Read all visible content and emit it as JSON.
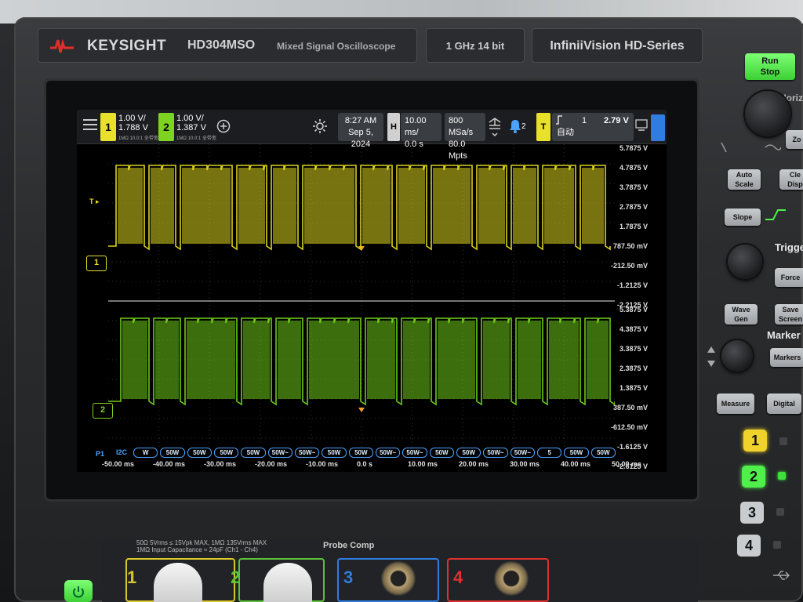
{
  "branding": {
    "company": "KEYSIGHT",
    "model": "HD304MSO",
    "type": "Mixed Signal Oscilloscope",
    "spec": "1 GHz  14 bit",
    "series": "InfiniiVision  HD-Series"
  },
  "topbar": {
    "ch1": {
      "num": "1",
      "scale": "1.00 V/",
      "offset": "1.788 V",
      "meta": "1MΩ  10.0:1  全带宽"
    },
    "ch2": {
      "num": "2",
      "scale": "1.00 V/",
      "offset": "1.387 V",
      "meta": "1MΩ  10.0:1  全带宽"
    },
    "add_icon": "plus-circle-icon",
    "brightness_icon": "sun-icon",
    "time": "8:27 AM",
    "date": "Sep 5, 2024",
    "horizontal_label": "H",
    "timebase": "10.00 ms/",
    "delay": "0.0 s",
    "sample_rate": "800 MSa/s",
    "memory": "80.0 Mpts",
    "notifications": "2",
    "trigger_label": "T",
    "trigger_source": "1",
    "trigger_mode": "自动",
    "trigger_level": "2.79 V"
  },
  "colors": {
    "ch1": "#e8e02a",
    "ch2": "#7ed321",
    "trace_ch1": "#d9d21e",
    "trace_ch2": "#6fc91a",
    "run_stop": "#4ff04a"
  },
  "ch1_labels": [
    "5.7875 V",
    "4.7875 V",
    "3.7875 V",
    "2.7875 V",
    "1.7875 V",
    "787.50 mV",
    "-212.50 mV",
    "-1.2125 V",
    "-2.2125 V"
  ],
  "ch2_labels": [
    "5.3875 V",
    "4.3875 V",
    "3.3875 V",
    "2.3875 V",
    "1.3875 V",
    "387.50 mV",
    "-612.50 mV",
    "-1.6125 V",
    "-2.6125 V"
  ],
  "time_labels": [
    "-50.00 ms",
    "-40.00 ms",
    "-30.00 ms",
    "-20.00 ms",
    "-10.00 ms",
    "0.0 s",
    "10.00 ms",
    "20.00 ms",
    "30.00 ms",
    "40.00 ms",
    "50.00 ms"
  ],
  "markers": {
    "trigger": "T",
    "ch1": "1",
    "ch2": "2"
  },
  "decode": {
    "bus": "P1",
    "protocol": "I2C",
    "packets": [
      "W",
      "50W",
      "50W",
      "50W",
      "50W",
      "50W~",
      "50W~",
      "50W",
      "50W",
      "50W~",
      "50W~",
      "50W",
      "50W",
      "50W~",
      "50W~",
      "5",
      "50W",
      "50W"
    ]
  },
  "panel": {
    "run_stop": "Run\nStop",
    "horizontal_partial": "Horiz",
    "zoom_partial": "Zo",
    "auto_scale": "Auto\nScale",
    "clear_display_partial": "Cle\nDisp",
    "slope": "Slope",
    "trigger": "Trigge",
    "force": "Force",
    "wave_gen": "Wave\nGen",
    "save_screen": "Save\nScreen",
    "markers_section": "Marker",
    "markers_button": "Markers",
    "measure": "Measure",
    "digital": "Digital",
    "ch_buttons": [
      "1",
      "2",
      "3",
      "4"
    ]
  },
  "front": {
    "warning": "50Ω 5Vrms ≤ 15Vpk MAX, 1MΩ 135Vrms MAX",
    "warning2": "1MΩ Input Capacitance ≈ 24pF (Ch1 - Ch4)",
    "probe_comp": "Probe Comp",
    "inputs": [
      "1",
      "2",
      "3",
      "4"
    ]
  }
}
